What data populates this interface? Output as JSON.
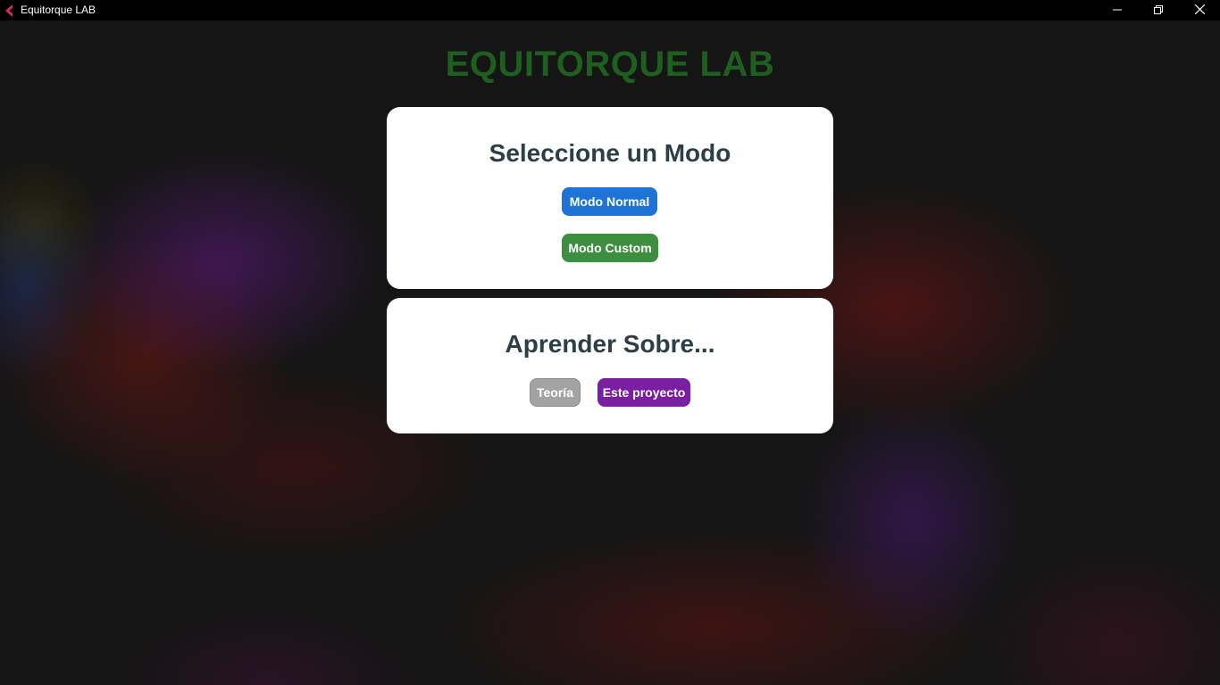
{
  "window": {
    "title": "Equitorque LAB",
    "controls": [
      "minimize",
      "restore",
      "close"
    ]
  },
  "app": {
    "heading": "EQUITORQUE LAB",
    "heading_color": "#1e5e1e"
  },
  "mode_card": {
    "title": "Seleccione un Modo",
    "buttons": [
      {
        "label": "Modo Normal",
        "color": "#1e74d6"
      },
      {
        "label": "Modo Custom",
        "color": "#3e8e40"
      }
    ]
  },
  "learn_card": {
    "title": "Aprender Sobre...",
    "buttons": [
      {
        "label": "Teoría",
        "color": "#a3a3a3"
      },
      {
        "label": "Este proyecto",
        "color": "#7a1fa4"
      }
    ]
  },
  "colors": {
    "titlebar": "#000000",
    "card_background": "#ffffff",
    "card_title": "#2c3e48"
  }
}
